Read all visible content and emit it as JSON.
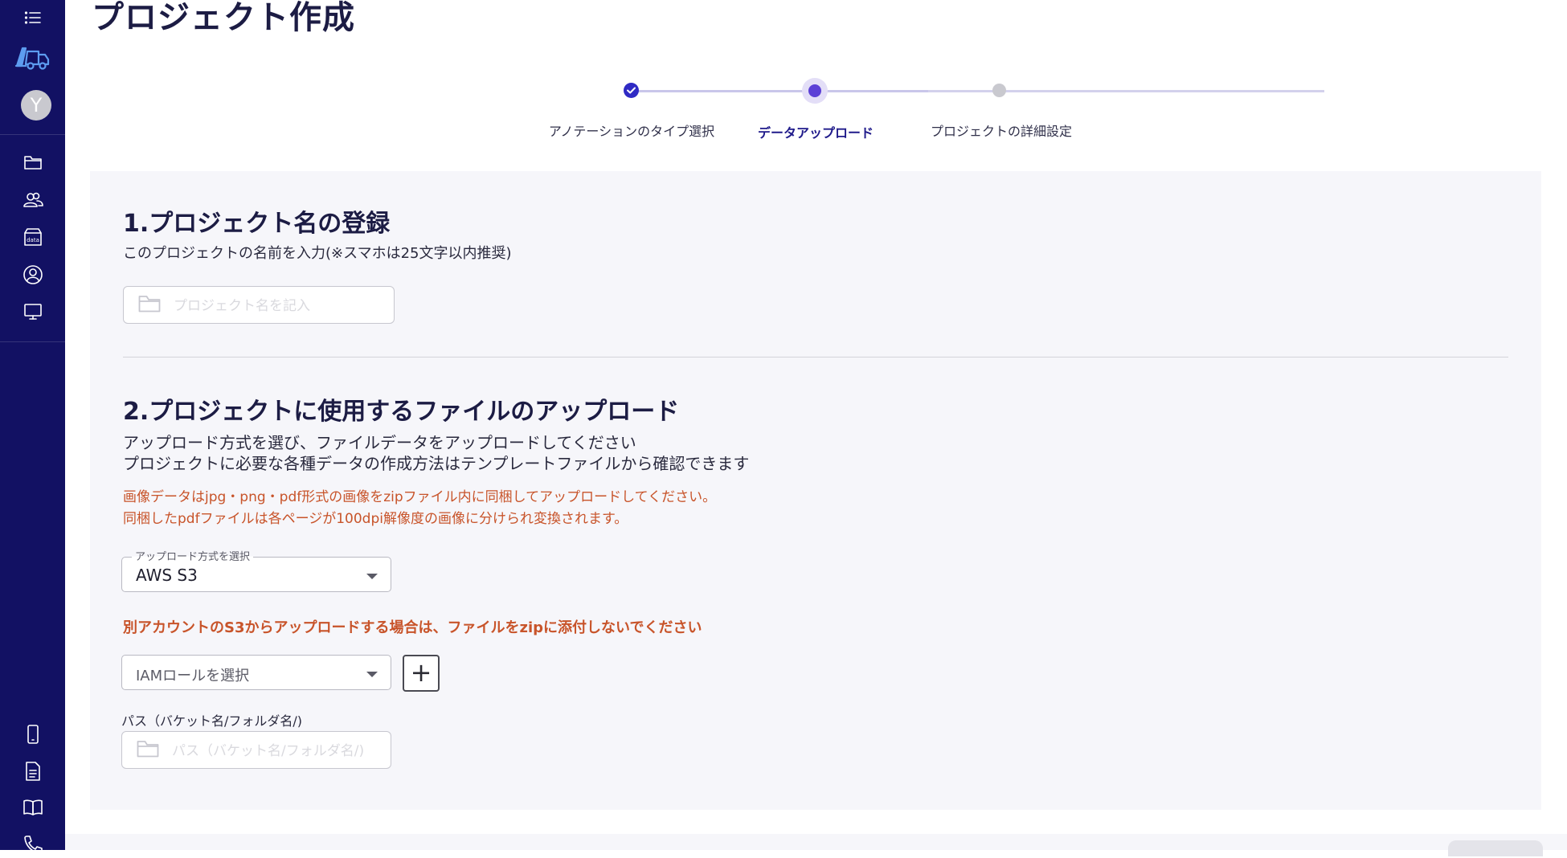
{
  "sidebar": {
    "avatar_initial": "Y",
    "icons": [
      "menu-icon",
      "logo-icon",
      "folder-icon",
      "users-icon",
      "data-icon",
      "account-icon",
      "monitor-icon",
      "phone-icon",
      "document-icon",
      "book-icon",
      "call-icon"
    ],
    "data_icon_text": "data"
  },
  "page": {
    "title": "プロジェクト作成"
  },
  "stepper": {
    "steps": [
      {
        "label": "アノテーションのタイプ選択",
        "state": "completed"
      },
      {
        "label": "データアップロード",
        "state": "active"
      },
      {
        "label": "プロジェクトの詳細設定",
        "state": "pending"
      }
    ]
  },
  "section1": {
    "title": "1.プロジェクト名の登録",
    "description": "このプロジェクトの名前を入力(※スマホは25文字以内推奨)",
    "name_input": {
      "placeholder": "プロジェクト名を記入",
      "value": ""
    }
  },
  "section2": {
    "title": "2.プロジェクトに使用するファイルのアップロード",
    "description_line1": "アップロード方式を選び、ファイルデータをアップロードしてください",
    "description_line2": "プロジェクトに必要な各種データの作成方法はテンプレートファイルから確認できます",
    "note_line1": "画像データはjpg・png・pdf形式の画像をzipファイル内に同梱してアップロードしてください。",
    "note_line2": "同梱したpdfファイルは各ページが100dpi解像度の画像に分けられ変換されます。",
    "upload_method": {
      "label": "アップロード方式を選択",
      "value": "AWS S3"
    },
    "s3_warning": "別アカウントのS3からアップロードする場合は、ファイルをzipに添付しないでください",
    "iam_role": {
      "placeholder": "IAMロールを選択"
    },
    "add_button_label": "+",
    "path": {
      "label": "パス（バケット名/フォルダ名/)",
      "placeholder": "パス（バケット名/フォルダ名/)",
      "value": ""
    }
  },
  "colors": {
    "sidebar_bg": "#121163",
    "accent": "#5b3fd6",
    "warning": "#c8542a",
    "panel_bg": "#f6f6fa"
  }
}
